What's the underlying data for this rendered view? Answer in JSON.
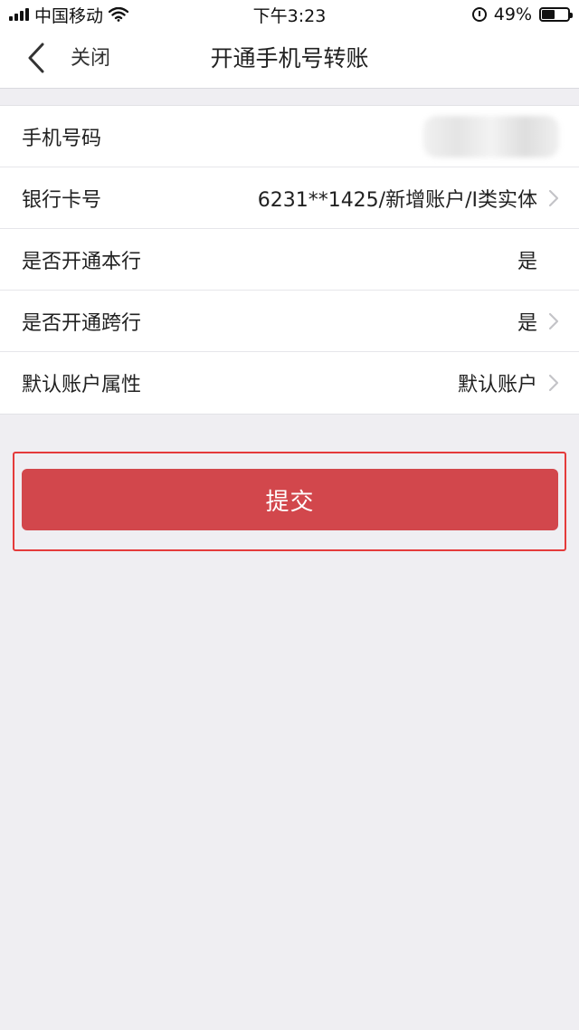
{
  "status_bar": {
    "carrier": "中国移动",
    "time": "下午3:23",
    "battery_percent": "49%",
    "battery_level": 0.49,
    "icons": [
      "signal-icon",
      "wifi-icon",
      "alarm-icon",
      "battery-icon"
    ]
  },
  "nav": {
    "close_label": "关闭",
    "title": "开通手机号转账"
  },
  "form": {
    "rows": [
      {
        "label": "手机号码",
        "value": ""
      },
      {
        "label": "银行卡号",
        "value": "6231**1425/新增账户/I类实体"
      },
      {
        "label": "是否开通本行",
        "value": "是"
      },
      {
        "label": "是否开通跨行",
        "value": "是"
      },
      {
        "label": "默认账户属性",
        "value": "默认账户"
      }
    ]
  },
  "actions": {
    "submit_label": "提交"
  },
  "colors": {
    "accent": "#d2474c",
    "highlight_frame": "#e43b3b",
    "background": "#efeef2"
  }
}
